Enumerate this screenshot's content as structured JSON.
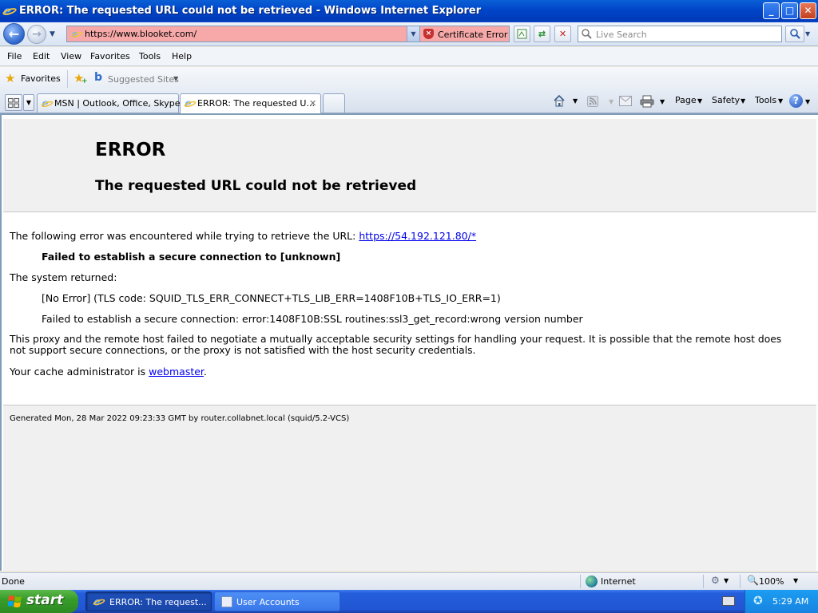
{
  "window": {
    "title": "ERROR: The requested URL could not be retrieved - Windows Internet Explorer",
    "minimize_glyph": "_",
    "maximize_glyph": "□",
    "close_glyph": "✕"
  },
  "navbar": {
    "url": "https://www.blooket.com/",
    "certificate_label": "Certificate Error",
    "search_placeholder": "Live Search"
  },
  "menu": [
    "File",
    "Edit",
    "View",
    "Favorites",
    "Tools",
    "Help"
  ],
  "favorites_bar": {
    "favorites_label": "Favorites",
    "suggested_sites_label": "Suggested Sites"
  },
  "tabs": [
    {
      "label": "MSN | Outlook, Office, Skype...",
      "active": false
    },
    {
      "label": "ERROR: The requested U...",
      "active": true
    }
  ],
  "command_bar": {
    "page_label": "Page",
    "safety_label": "Safety",
    "tools_label": "Tools"
  },
  "page": {
    "heading": "ERROR",
    "subheading": "The requested URL could not be retrieved",
    "intro": "The following error was encountered while trying to retrieve the URL:",
    "intro_link": "https://54.192.121.80/*",
    "failed_bold": "Failed to establish a secure connection to [unknown]",
    "system_returned": "The system returned:",
    "error_line1": "[No Error] (TLS code: SQUID_TLS_ERR_CONNECT+TLS_LIB_ERR=1408F10B+TLS_IO_ERR=1)",
    "error_line2": "Failed to establish a secure connection: error:1408F10B:SSL routines:ssl3_get_record:wrong version number",
    "explanation_line1": "This proxy and the remote host failed to negotiate a mutually acceptable security settings for handling your request. It is possible that the remote host does",
    "explanation_line2": "not support secure connections, or the proxy is not satisfied with the host security credentials.",
    "admin_prefix": "Your cache administrator is",
    "admin_link": "webmaster",
    "admin_suffix": ".",
    "generated": "Generated Mon, 28 Mar 2022 09:23:33 GMT by router.collabnet.local (squid/5.2-VCS)"
  },
  "statusbar": {
    "status_text": "Done",
    "zone": "Internet",
    "zoom": "100%"
  },
  "taskbar": {
    "start_label": "start",
    "buttons": [
      {
        "label": "ERROR: The request...",
        "active": true
      },
      {
        "label": "User Accounts",
        "active": false
      }
    ],
    "clock": "5:29 AM"
  },
  "colors": {
    "titlebar": "#0045c8",
    "address_error_bg": "#f7a9a9",
    "link": "#0000ee",
    "taskbar": "#245edb",
    "start": "#379c2a"
  },
  "icons": [
    "ie-icon",
    "back-arrow-icon",
    "forward-arrow-icon",
    "certificate-shield-icon",
    "compatibility-icon",
    "refresh-icon",
    "stop-icon",
    "search-icon",
    "favorites-star-icon",
    "add-favorites-icon",
    "bing-icon",
    "quick-tabs-icon",
    "home-icon",
    "rss-feeds-icon",
    "read-mail-icon",
    "print-icon",
    "help-icon",
    "globe-icon",
    "protected-mode-icon",
    "zoom-icon",
    "windows-logo-icon",
    "user-accounts-icon",
    "keyboard-icon",
    "network-icon"
  ]
}
